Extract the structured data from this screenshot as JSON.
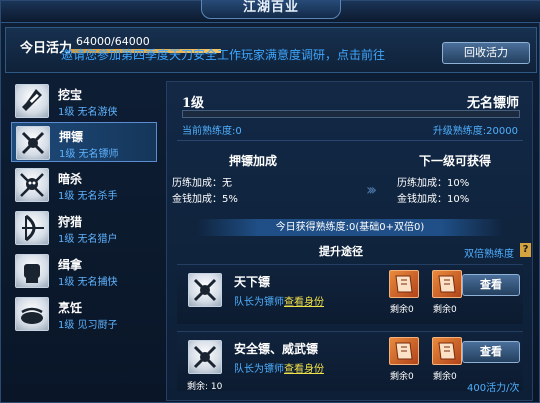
{
  "window": {
    "title": "江湖百业"
  },
  "vitality": {
    "label": "今日活力",
    "value": "64000/64000",
    "fraction": 1.0,
    "notice": "邀请您参加第四季度天刀安全工作玩家满意度调研，点击前往",
    "recycle_button": "回收活力"
  },
  "jobs": [
    {
      "name": "挖宝",
      "level": "1级 无名游侠",
      "icon": "shovel-icon",
      "selected": false
    },
    {
      "name": "押镖",
      "level": "1级 无名镖师",
      "icon": "crossed-swords-icon",
      "selected": true
    },
    {
      "name": "暗杀",
      "level": "1级 无名杀手",
      "icon": "skull-daggers-icon",
      "selected": false
    },
    {
      "name": "狩猎",
      "level": "1级 无名猎户",
      "icon": "bow-icon",
      "selected": false
    },
    {
      "name": "缉拿",
      "level": "1级 无名捕快",
      "icon": "fist-icon",
      "selected": false
    },
    {
      "name": "烹饪",
      "level": "1级 见习厨子",
      "icon": "pot-icon",
      "selected": false
    }
  ],
  "detail": {
    "level": "1级",
    "rank": "无名镖师",
    "exp_fraction": 0,
    "current_exp": "当前熟练度:0",
    "upgrade_exp": "升级熟练度:20000",
    "bonus": {
      "current_title": "押镖加成",
      "next_title": "下一级可获得",
      "current_rows": [
        "历练加成：无",
        "金钱加成：5%"
      ],
      "next_rows": [
        "历练加成：10%",
        "金钱加成：10%"
      ]
    },
    "daily_exp": "今日获得熟练度:0(基础0+双倍0)",
    "path_title": "提升途径",
    "double_exp": "双倍熟练度",
    "help": "?"
  },
  "routes": [
    {
      "name": "天下镖",
      "note": "队长为镖师",
      "link": "查看身份",
      "left_remain": "",
      "book1_remain": "剩余0",
      "book2_remain": "剩余0",
      "button": "查看",
      "cost": ""
    },
    {
      "name": "安全镖、威武镖",
      "note": "队长为镖师",
      "link": "查看身份",
      "left_remain": "剩余: 10",
      "book1_remain": "剩余0",
      "book2_remain": "剩余0",
      "button": "查看",
      "cost": "400活力/次"
    }
  ],
  "colors": {
    "accent_blue": "#4fb0ff",
    "link_yellow": "#f0e04a",
    "book_orange": "#d8692a"
  }
}
